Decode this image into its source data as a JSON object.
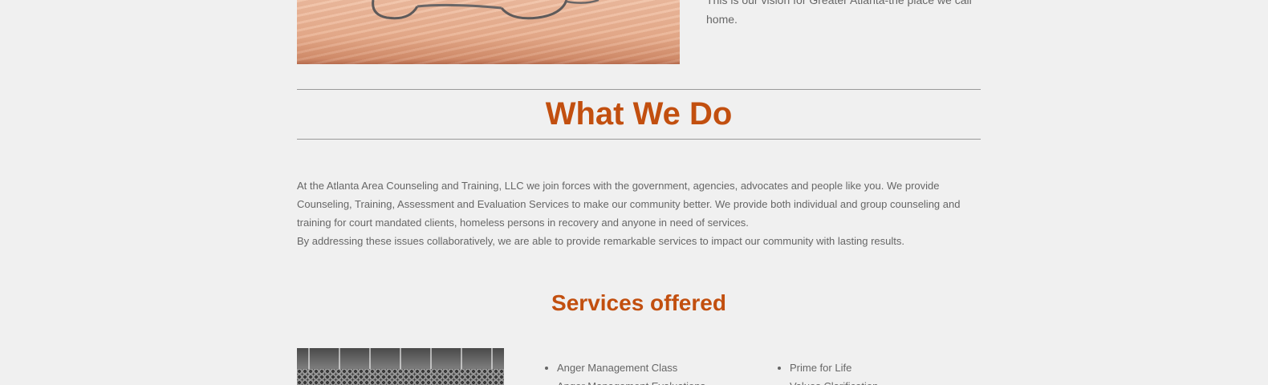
{
  "vision": {
    "text": "This is our vision for Greater Atlanta-the place we call home."
  },
  "what_we_do": {
    "title": "What We Do",
    "paragraph_1": "At the Atlanta Area Counseling and Training, LLC we join forces with the government, agencies, advocates and people like you. We provide Counseling, Training, Assessment and Evaluation Services to make our community better. We provide both individual and group counseling and training for court mandated clients, homeless persons in recovery and anyone in need of services.",
    "paragraph_2": "By addressing these issues collaboratively, we are able to provide remarkable services to impact our community with lasting results."
  },
  "services": {
    "title": "Services offered",
    "column_1": [
      "Anger Management Class",
      "Anger Management Evaluations"
    ],
    "column_2": [
      "Prime for Life",
      "Values Clarification"
    ]
  },
  "colors": {
    "accent": "#c24f0f",
    "background": "#f0f0f0",
    "body_text": "#666666"
  }
}
